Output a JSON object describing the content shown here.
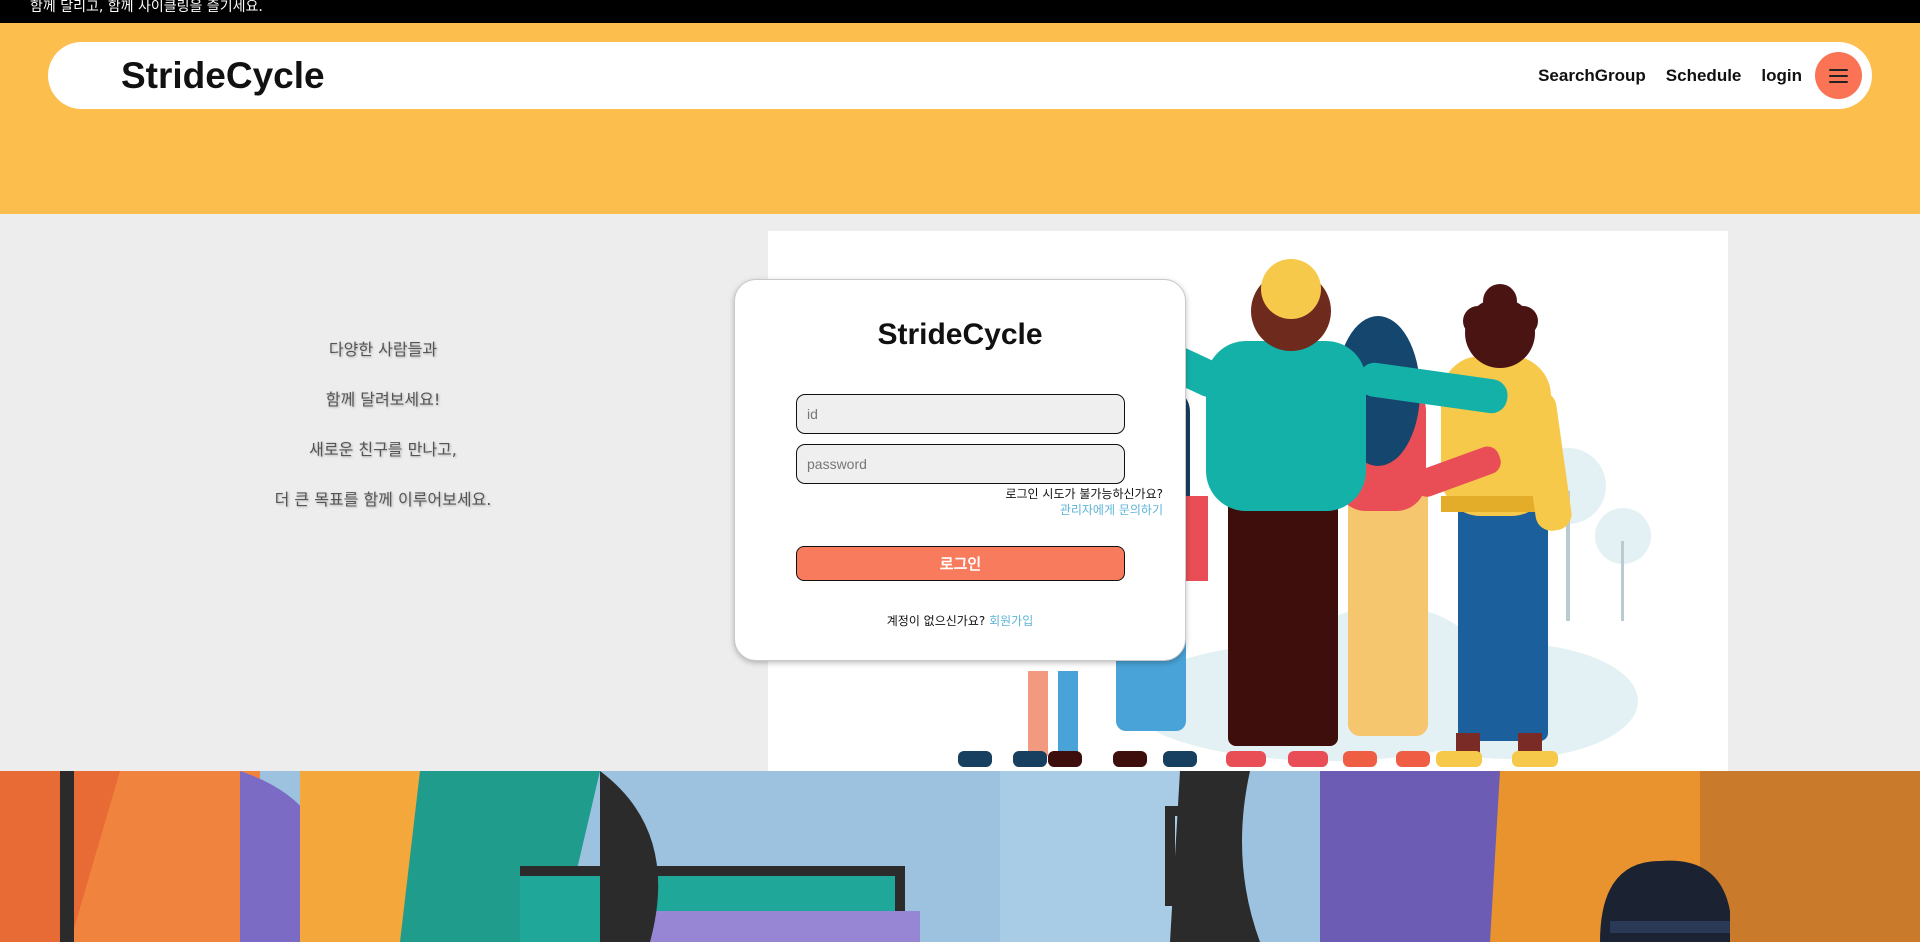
{
  "topbar": {
    "text": "함께 달리고, 함께 사이클링을 즐기세요."
  },
  "navbar": {
    "brand": "StrideCycle",
    "links": [
      "SearchGroup",
      "Schedule",
      "login"
    ],
    "menu_icon": "hamburger-icon"
  },
  "slogan": [
    "다양한 사람들과",
    "함께 달려보세요!",
    "새로운 친구를 만나고,",
    "더 큰 목표를 함께 이루어보세요."
  ],
  "login": {
    "title": "StrideCycle",
    "id_placeholder": "id",
    "password_placeholder": "password",
    "help_text": "로그인 시도가 불가능하신가요?",
    "help_link": "관리자에게 문의하기",
    "submit_label": "로그인",
    "signup_text": "계정이 없으신가요?",
    "signup_link": "회원가입"
  },
  "colors": {
    "header_yellow": "#fcbe4c",
    "accent_coral": "#f97354",
    "link_blue": "#5fb4d8",
    "background_gray": "#ededed"
  }
}
